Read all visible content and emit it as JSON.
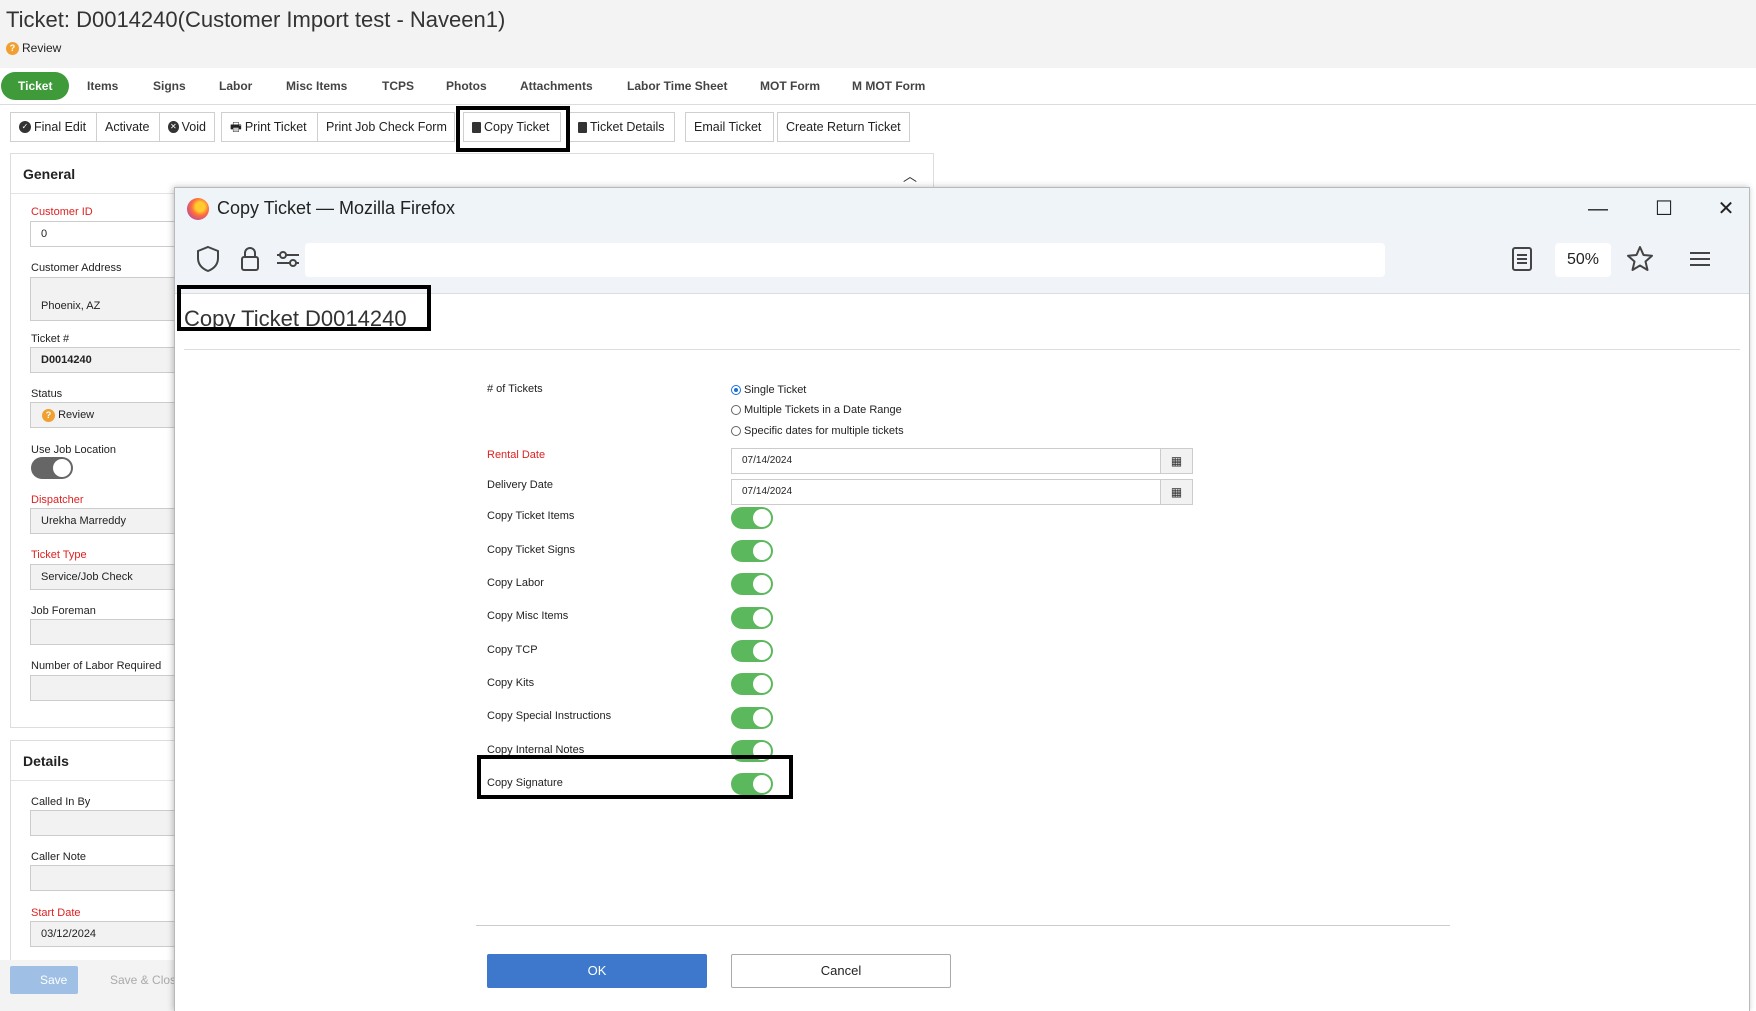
{
  "page": {
    "title": "Ticket: D0014240(Customer Import test - Naveen1)",
    "status_icon": "question-icon",
    "status": "Review"
  },
  "tabs": [
    "Ticket",
    "Items",
    "Signs",
    "Labor",
    "Misc Items",
    "TCPS",
    "Photos",
    "Attachments",
    "Labor Time Sheet",
    "MOT Form",
    "M MOT Form"
  ],
  "toolbar": {
    "final_edit": "Final Edit",
    "activate": "Activate",
    "void": "Void",
    "print_ticket": "Print Ticket",
    "print_job_check": "Print Job Check Form",
    "copy_ticket": "Copy Ticket",
    "ticket_details": "Ticket Details",
    "email_ticket": "Email Ticket",
    "create_return": "Create Return Ticket"
  },
  "general": {
    "heading": "General",
    "customer_id_label": "Customer ID",
    "customer_id": "0",
    "customer_address_label": "Customer Address",
    "customer_address": "Phoenix, AZ",
    "ticket_no_label": "Ticket #",
    "ticket_no": "D0014240",
    "status_label": "Status",
    "status": "Review",
    "use_job_location_label": "Use Job Location",
    "dispatcher_label": "Dispatcher",
    "dispatcher": "Urekha Marreddy",
    "ticket_type_label": "Ticket Type",
    "ticket_type": "Service/Job Check",
    "job_foreman_label": "Job Foreman",
    "labor_required_label": "Number of Labor Required"
  },
  "details": {
    "heading": "Details",
    "called_in_by_label": "Called In By",
    "caller_note_label": "Caller Note",
    "start_date_label": "Start Date",
    "start_date": "03/12/2024"
  },
  "bottom": {
    "save": "Save",
    "save_close": "Save & Clos"
  },
  "firefox": {
    "window_title": "Copy Ticket — Mozilla Firefox",
    "zoom": "50%"
  },
  "dialog": {
    "title": "Copy Ticket D0014240",
    "num_tickets_label": "# of Tickets",
    "radio_options": [
      "Single Ticket",
      "Multiple Tickets in a Date Range",
      "Specific dates for multiple tickets"
    ],
    "selected_option": "Single Ticket",
    "rental_date_label": "Rental Date",
    "rental_date": "07/14/2024",
    "delivery_date_label": "Delivery Date",
    "delivery_date": "07/14/2024",
    "toggles": [
      {
        "label": "Copy Ticket Items",
        "on": true
      },
      {
        "label": "Copy Ticket Signs",
        "on": true
      },
      {
        "label": "Copy Labor",
        "on": true
      },
      {
        "label": "Copy Misc Items",
        "on": true
      },
      {
        "label": "Copy TCP",
        "on": true
      },
      {
        "label": "Copy Kits",
        "on": true
      },
      {
        "label": "Copy Special Instructions",
        "on": true
      },
      {
        "label": "Copy Internal Notes",
        "on": true
      },
      {
        "label": "Copy Signature",
        "on": true
      }
    ],
    "ok": "OK",
    "cancel": "Cancel"
  }
}
